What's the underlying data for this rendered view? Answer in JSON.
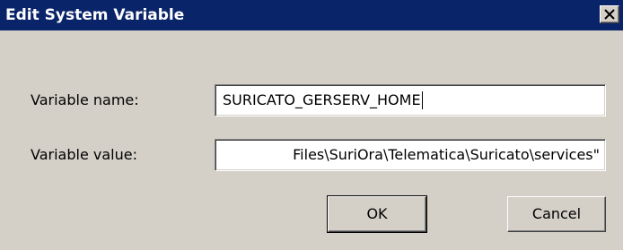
{
  "window": {
    "title": "Edit System Variable",
    "close_icon": "close-x"
  },
  "form": {
    "name_label": "Variable name:",
    "name_value": "SURICATO_GERSERV_HOME",
    "value_label": "Variable value:",
    "value_value": "Files\\SuriOra\\Telematica\\Suricato\\services\""
  },
  "buttons": {
    "ok_label": "OK",
    "cancel_label": "Cancel"
  },
  "colors": {
    "titlebar": "#0a246a",
    "dialog_face": "#d4d0c8"
  }
}
